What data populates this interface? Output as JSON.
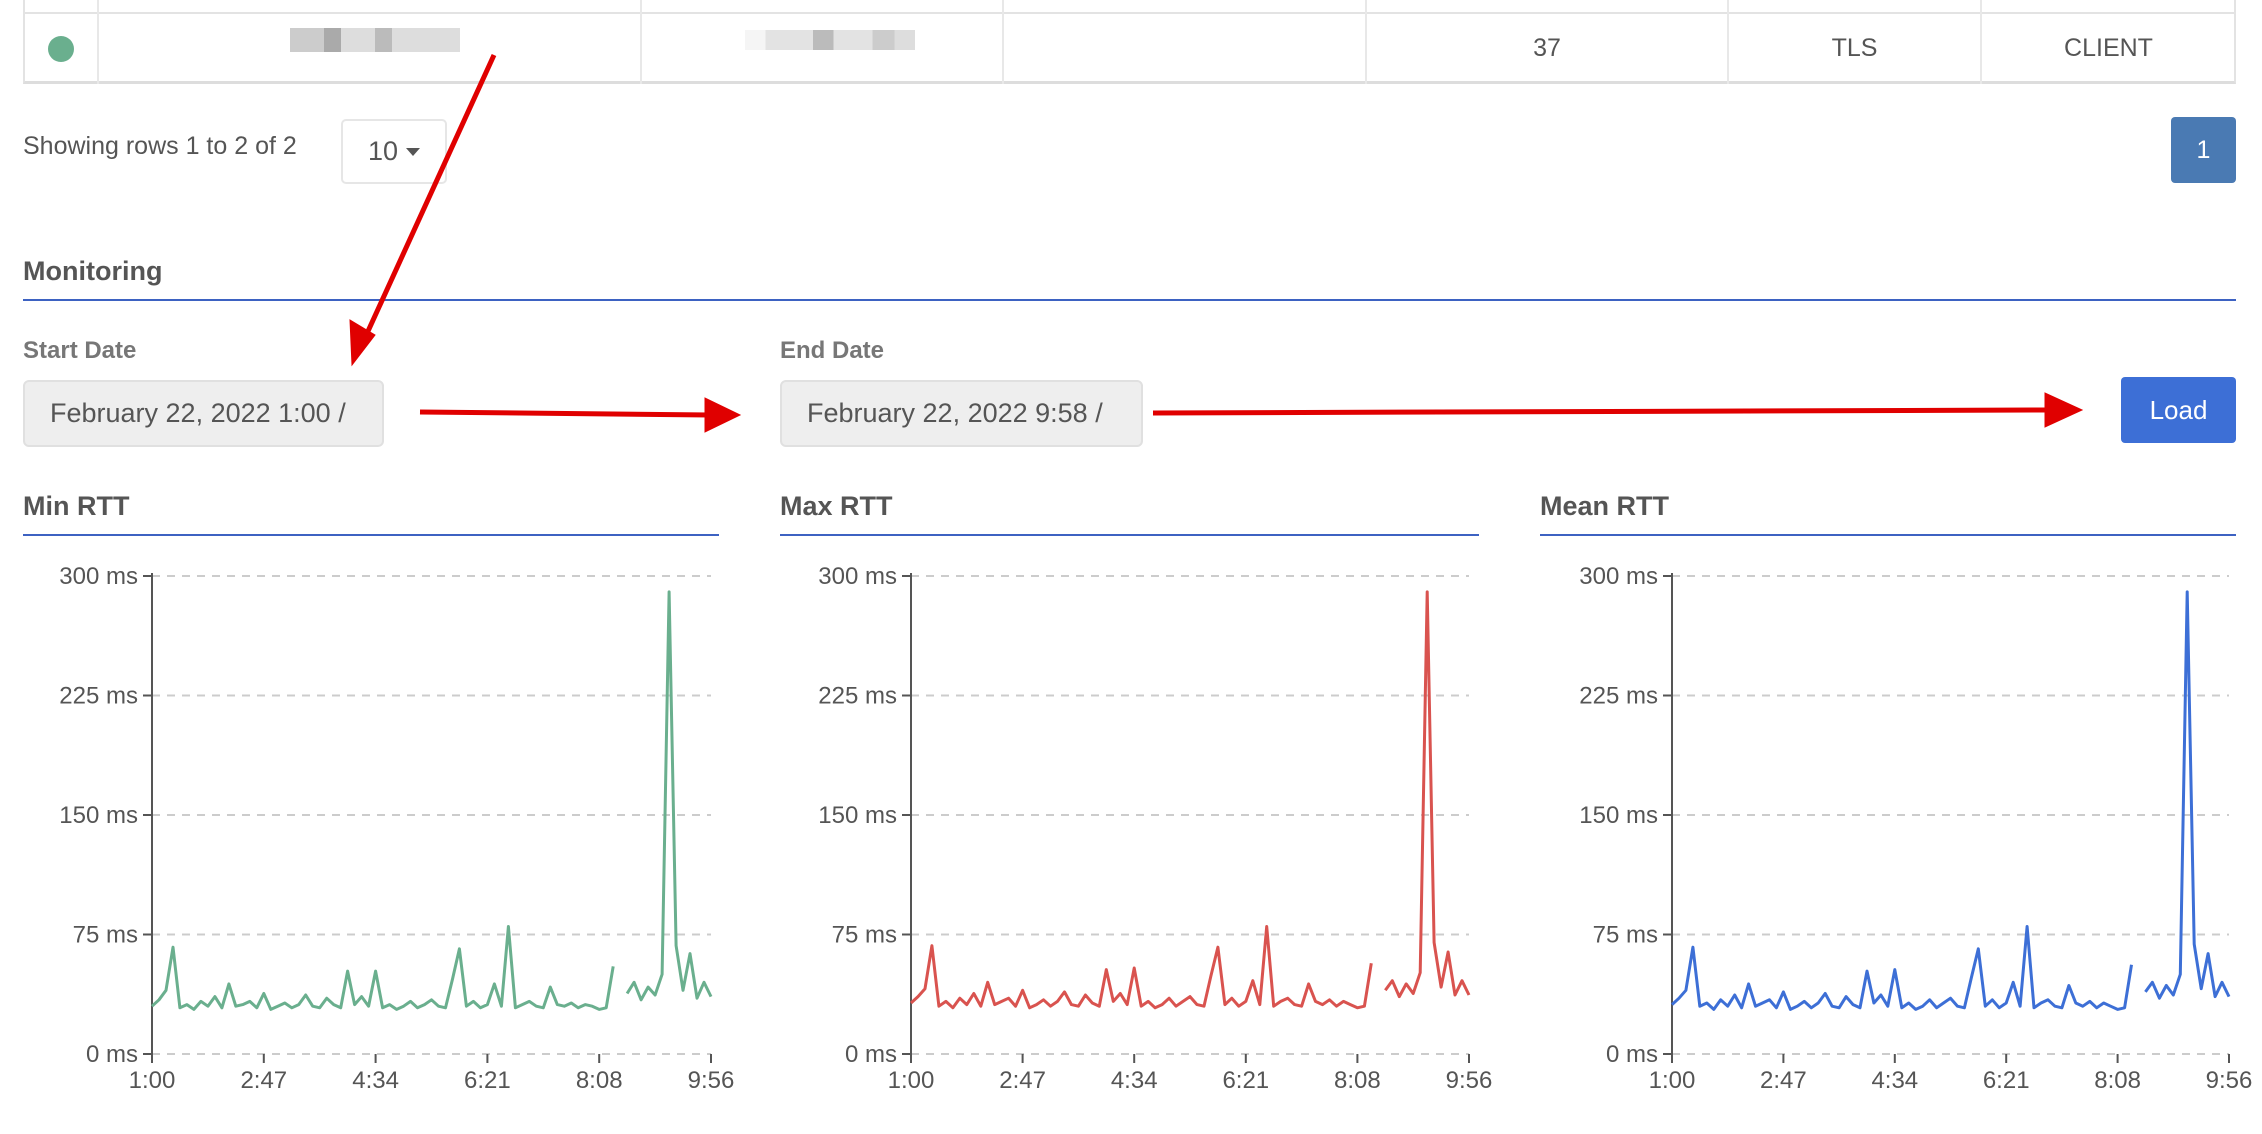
{
  "table": {
    "row": {
      "status_color": "#6aaf8e",
      "count": "37",
      "protocol": "TLS",
      "role": "CLIENT"
    }
  },
  "pagination": {
    "summary": "Showing rows 1 to 2 of 2",
    "page_size": "10",
    "current_page": "1"
  },
  "monitoring": {
    "title": "Monitoring",
    "start_label": "Start Date",
    "start_value": "February 22, 2022 1:00 /",
    "end_label": "End Date",
    "end_value": "February 22, 2022 9:58 /",
    "load_label": "Load",
    "accent": "#3d62c2"
  },
  "chart_data": [
    {
      "type": "line",
      "title": "Min RTT",
      "color": "#6aaf8e",
      "ylim": [
        0,
        300
      ],
      "yticks": [
        "0 ms",
        "75 ms",
        "150 ms",
        "225 ms",
        "300 ms"
      ],
      "ytick_values": [
        0,
        75,
        150,
        225,
        300
      ],
      "xticks": [
        "1:00",
        "2:47",
        "4:34",
        "6:21",
        "8:08",
        "9:56"
      ],
      "x_range": [
        "1:00",
        "9:56"
      ],
      "grid": "horizontal dashed",
      "values": [
        30,
        34,
        40,
        67,
        29,
        31,
        28,
        33,
        30,
        36,
        29,
        44,
        30,
        31,
        33,
        29,
        38,
        28,
        30,
        32,
        29,
        31,
        37,
        30,
        29,
        35,
        31,
        29,
        52,
        31,
        36,
        30,
        52,
        29,
        31,
        28,
        30,
        33,
        29,
        31,
        34,
        30,
        29,
        47,
        66,
        30,
        33,
        29,
        31,
        44,
        30,
        80,
        29,
        31,
        33,
        30,
        29,
        42,
        31,
        30,
        32,
        29,
        31,
        30,
        28,
        29,
        55,
        null,
        38,
        45,
        34,
        42,
        37,
        50,
        290,
        68,
        40,
        63,
        35,
        45,
        36
      ]
    },
    {
      "type": "line",
      "title": "Max RTT",
      "color": "#d9534f",
      "ylim": [
        0,
        300
      ],
      "yticks": [
        "0 ms",
        "75 ms",
        "150 ms",
        "225 ms",
        "300 ms"
      ],
      "ytick_values": [
        0,
        75,
        150,
        225,
        300
      ],
      "xticks": [
        "1:00",
        "2:47",
        "4:34",
        "6:21",
        "8:08",
        "9:56"
      ],
      "x_range": [
        "1:00",
        "9:56"
      ],
      "grid": "horizontal dashed",
      "values": [
        32,
        36,
        41,
        68,
        30,
        33,
        29,
        35,
        31,
        38,
        30,
        45,
        31,
        33,
        35,
        30,
        40,
        29,
        31,
        34,
        30,
        33,
        39,
        31,
        30,
        37,
        32,
        30,
        53,
        33,
        38,
        31,
        54,
        30,
        33,
        29,
        31,
        35,
        30,
        33,
        36,
        31,
        30,
        49,
        67,
        31,
        35,
        30,
        33,
        46,
        31,
        80,
        30,
        33,
        35,
        31,
        30,
        44,
        33,
        31,
        34,
        30,
        33,
        31,
        29,
        30,
        57,
        null,
        40,
        46,
        36,
        44,
        38,
        51,
        290,
        70,
        42,
        64,
        37,
        46,
        37
      ]
    },
    {
      "type": "line",
      "title": "Mean RTT",
      "color": "#3d6fd6",
      "ylim": [
        0,
        300
      ],
      "yticks": [
        "0 ms",
        "75 ms",
        "150 ms",
        "225 ms",
        "300 ms"
      ],
      "ytick_values": [
        0,
        75,
        150,
        225,
        300
      ],
      "xticks": [
        "1:00",
        "2:47",
        "4:34",
        "6:21",
        "8:08",
        "9:56"
      ],
      "x_range": [
        "1:00",
        "9:56"
      ],
      "grid": "horizontal dashed",
      "values": [
        31,
        35,
        40,
        67,
        30,
        32,
        28,
        34,
        30,
        37,
        29,
        44,
        30,
        32,
        34,
        29,
        39,
        28,
        30,
        33,
        29,
        32,
        38,
        30,
        29,
        36,
        31,
        29,
        52,
        32,
        37,
        30,
        53,
        29,
        32,
        28,
        30,
        34,
        29,
        32,
        35,
        30,
        29,
        48,
        66,
        30,
        34,
        29,
        32,
        45,
        30,
        80,
        29,
        32,
        34,
        30,
        29,
        43,
        32,
        30,
        33,
        29,
        32,
        30,
        28,
        29,
        56,
        null,
        39,
        45,
        35,
        43,
        37,
        50,
        290,
        69,
        41,
        63,
        36,
        45,
        36
      ]
    }
  ]
}
